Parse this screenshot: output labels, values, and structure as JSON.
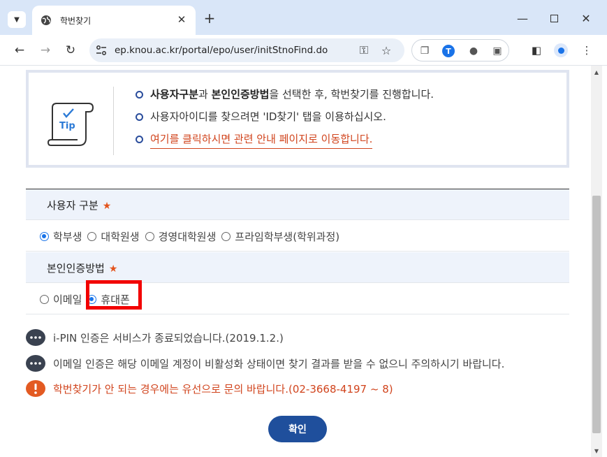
{
  "browser": {
    "tab_title": "학번찾기",
    "url": "ep.knou.ac.kr/portal/epo/user/initStnoFind.do"
  },
  "tip": {
    "badge": "Tip",
    "items": [
      {
        "bold1": "사용자구분",
        "t1": "과 ",
        "bold2": "본인인증방법",
        "t2": "을 선택한 후, 학번찾기를 진행합니다."
      },
      {
        "text": "사용자아이디를 찾으려면 'ID찾기' 탭을 이용하십시오."
      },
      {
        "link": "여기를 클릭하시면 관련 안내 페이지로 이동합니다."
      }
    ]
  },
  "form": {
    "user_type": {
      "label": "사용자 구분",
      "required_mark": "★",
      "options": [
        "학부생",
        "대학원생",
        "경영대학원생",
        "프라임학부생(학위과정)"
      ],
      "selected": "학부생"
    },
    "auth_method": {
      "label": "본인인증방법",
      "required_mark": "★",
      "options": [
        "이메일",
        "휴대폰"
      ],
      "selected": "휴대폰"
    }
  },
  "notices": [
    "i-PIN 인증은 서비스가 종료되었습니다.(2019.1.2.)",
    "이메일 인증은 해당 이메일 계정이 비활성화 상태이면 찾기 결과를 받을 수 없으니 주의하시기 바랍니다.",
    "학번찾기가 안 되는 경우에는 유선으로 문의 바랍니다.(02-3668-4197 ~ 8)"
  ],
  "confirm_label": "확인",
  "colors": {
    "accent_navy": "#1f4f9c",
    "warning_orange": "#d1441d",
    "highlight_red": "#f20000",
    "tab_strip": "#d9e6f8"
  }
}
